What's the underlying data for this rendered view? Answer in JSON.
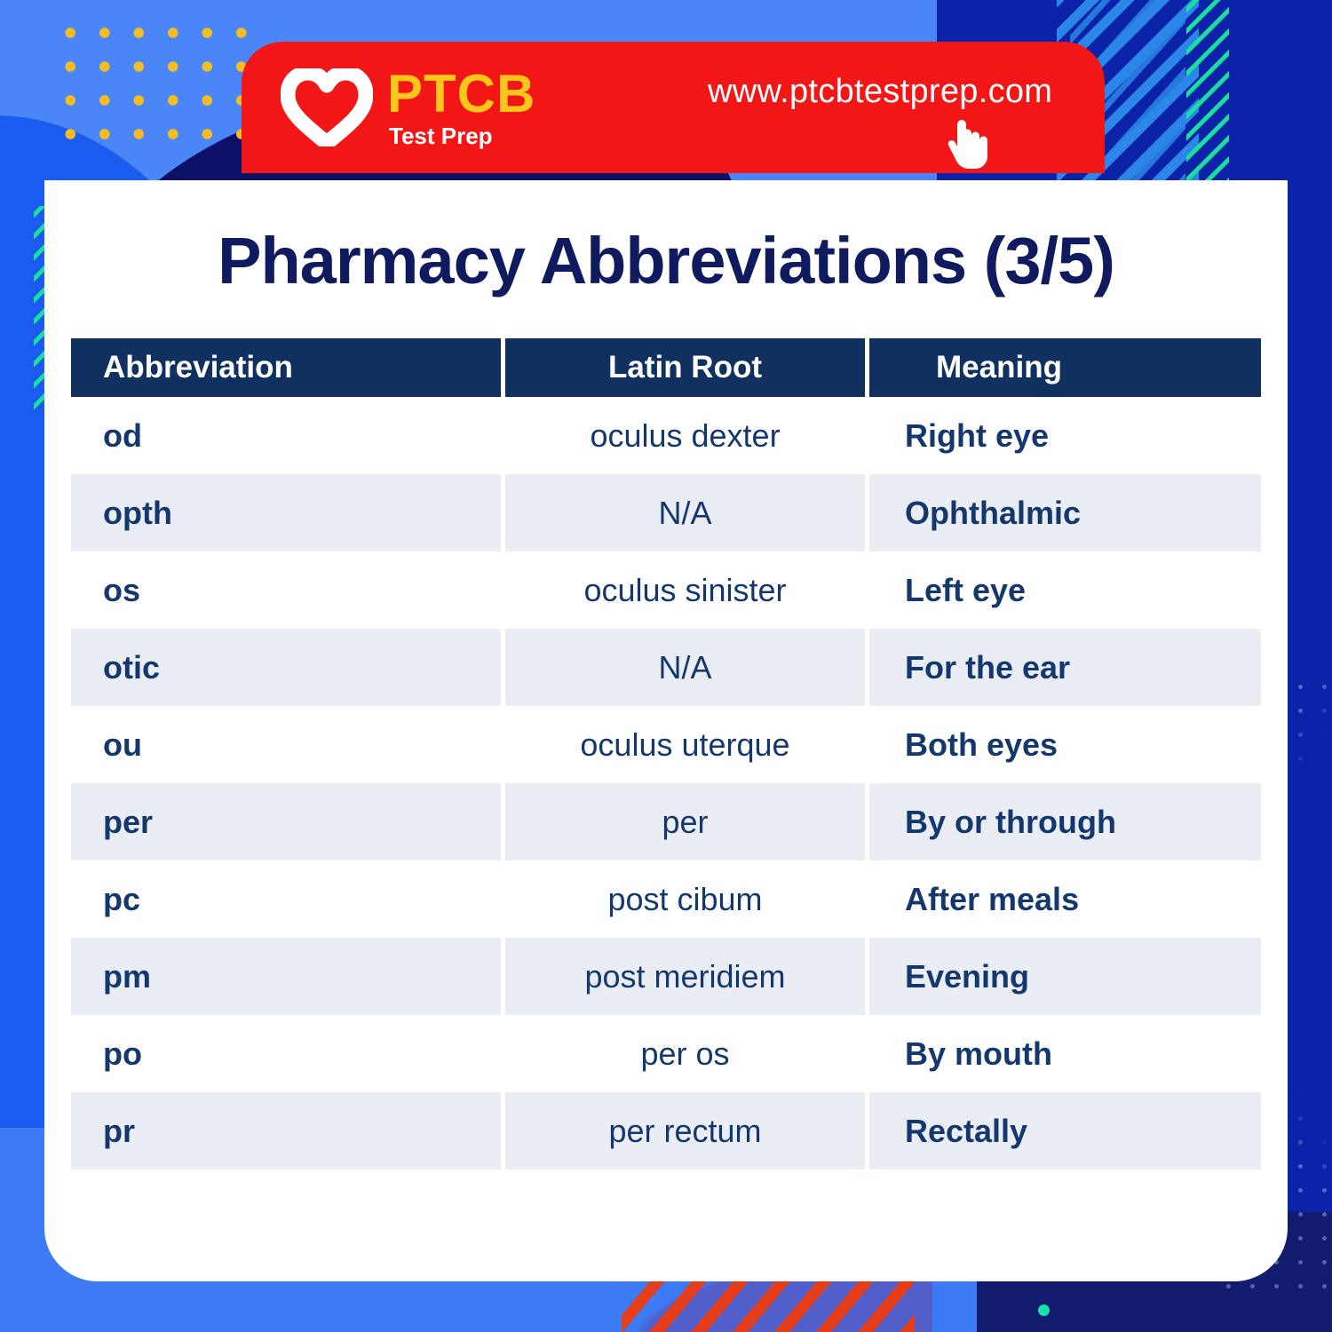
{
  "brand": {
    "logo_icon": "heart-icon",
    "name": "PTCB",
    "tagline": "Test Prep",
    "url": "www.ptcbtestprep.com",
    "cursor_icon": "pointing-hand-icon",
    "red": "#f21616",
    "yellow": "#ffc61a",
    "navy": "#101a5e"
  },
  "page": {
    "title": "Pharmacy Abbreviations (3/5)"
  },
  "table": {
    "headers": [
      "Abbreviation",
      "Latin Root",
      "Meaning"
    ],
    "rows": [
      {
        "abbreviation": "od",
        "latin_root": "oculus dexter",
        "meaning": "Right eye"
      },
      {
        "abbreviation": "opth",
        "latin_root": "N/A",
        "meaning": "Ophthalmic"
      },
      {
        "abbreviation": "os",
        "latin_root": "oculus sinister",
        "meaning": "Left eye"
      },
      {
        "abbreviation": "otic",
        "latin_root": "N/A",
        "meaning": "For the ear"
      },
      {
        "abbreviation": "ou",
        "latin_root": "oculus uterque",
        "meaning": "Both eyes"
      },
      {
        "abbreviation": "per",
        "latin_root": "per",
        "meaning": "By or through"
      },
      {
        "abbreviation": "pc",
        "latin_root": "post cibum",
        "meaning": "After meals"
      },
      {
        "abbreviation": "pm",
        "latin_root": "post meridiem",
        "meaning": "Evening"
      },
      {
        "abbreviation": "po",
        "latin_root": "per os",
        "meaning": "By mouth"
      },
      {
        "abbreviation": "pr",
        "latin_root": "per rectum",
        "meaning": "Rectally"
      }
    ]
  },
  "decor": {
    "x_marks": [
      "x",
      "x",
      "x",
      "x",
      "x",
      "x"
    ],
    "header_bg": "#103160",
    "alt_row_bg": "#eaeef4",
    "text_color": "#14386e",
    "green": "#18e0a0",
    "dot_yellow": "#f5bd1f"
  }
}
